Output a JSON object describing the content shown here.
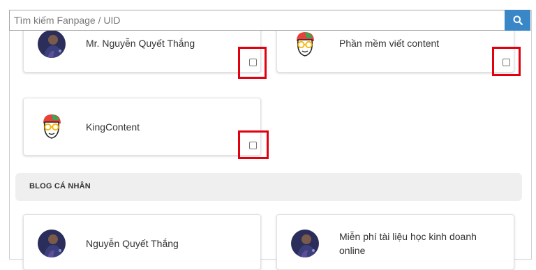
{
  "search": {
    "placeholder": "Tìm kiếm Fanpage / UID",
    "button_icon": "search-icon"
  },
  "cards": [
    {
      "name": "Mr. Nguyễn Quyết Thắng",
      "avatar": "person-avatar",
      "checked": false,
      "highlighted": true
    },
    {
      "name": "Phần mềm viết content",
      "avatar": "kingcontent-logo",
      "checked": false,
      "highlighted": true
    },
    {
      "name": "KingContent",
      "avatar": "kingcontent-logo",
      "checked": false,
      "highlighted": true
    }
  ],
  "section": {
    "title": "BLOG CÁ NHÂN"
  },
  "blog_cards": [
    {
      "name": "Nguyễn Quyết Thắng",
      "avatar": "person-avatar"
    },
    {
      "name_line1": "Miễn phí tài liệu học kinh doanh",
      "name_line2": "online",
      "avatar": "person-avatar"
    }
  ],
  "colors": {
    "accent": "#3a87c8",
    "highlight": "#e2000e",
    "section_bg": "#efefef"
  }
}
